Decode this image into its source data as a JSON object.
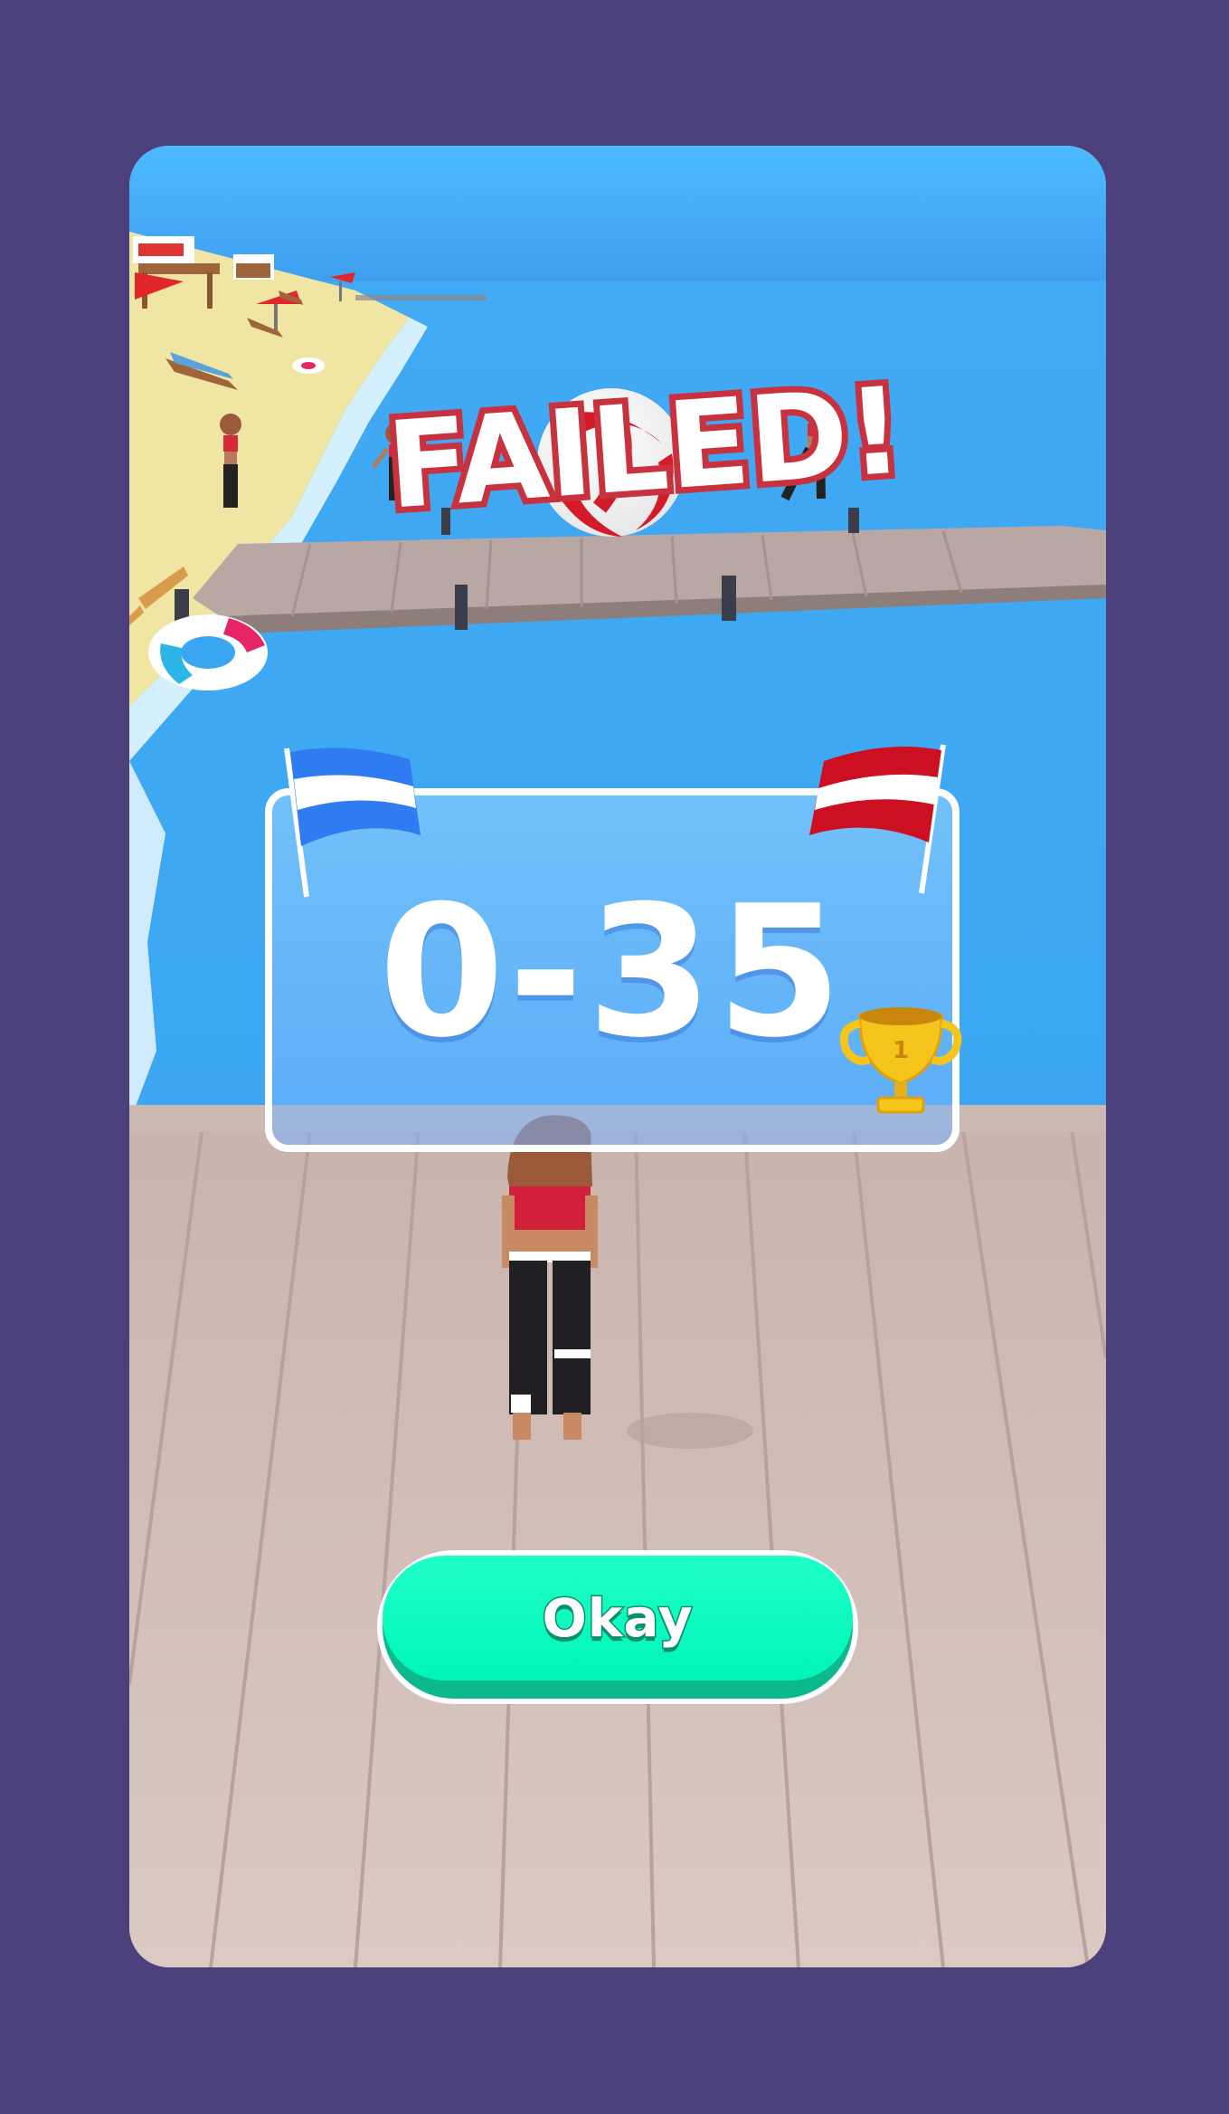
{
  "result": {
    "title": "FAILED!",
    "score": "0-35"
  },
  "flags": {
    "left_icon": "blue-white-striped-flag",
    "right_icon": "red-white-striped-flag",
    "left_color": "#2f7cf2",
    "right_color": "#cc1021"
  },
  "trophy": {
    "icon": "gold-trophy-icon",
    "color": "#f5c51c"
  },
  "okay_button": {
    "label": "Okay"
  },
  "colors": {
    "background": "#4b3f7c",
    "title_fill": "#ffffff",
    "title_outline": "#c8323f",
    "button": "#00f5ba",
    "water": "#3aa8f2",
    "sky": "#49b6fb",
    "sand": "#f1e5a3",
    "dock": "#d6c2bd"
  }
}
